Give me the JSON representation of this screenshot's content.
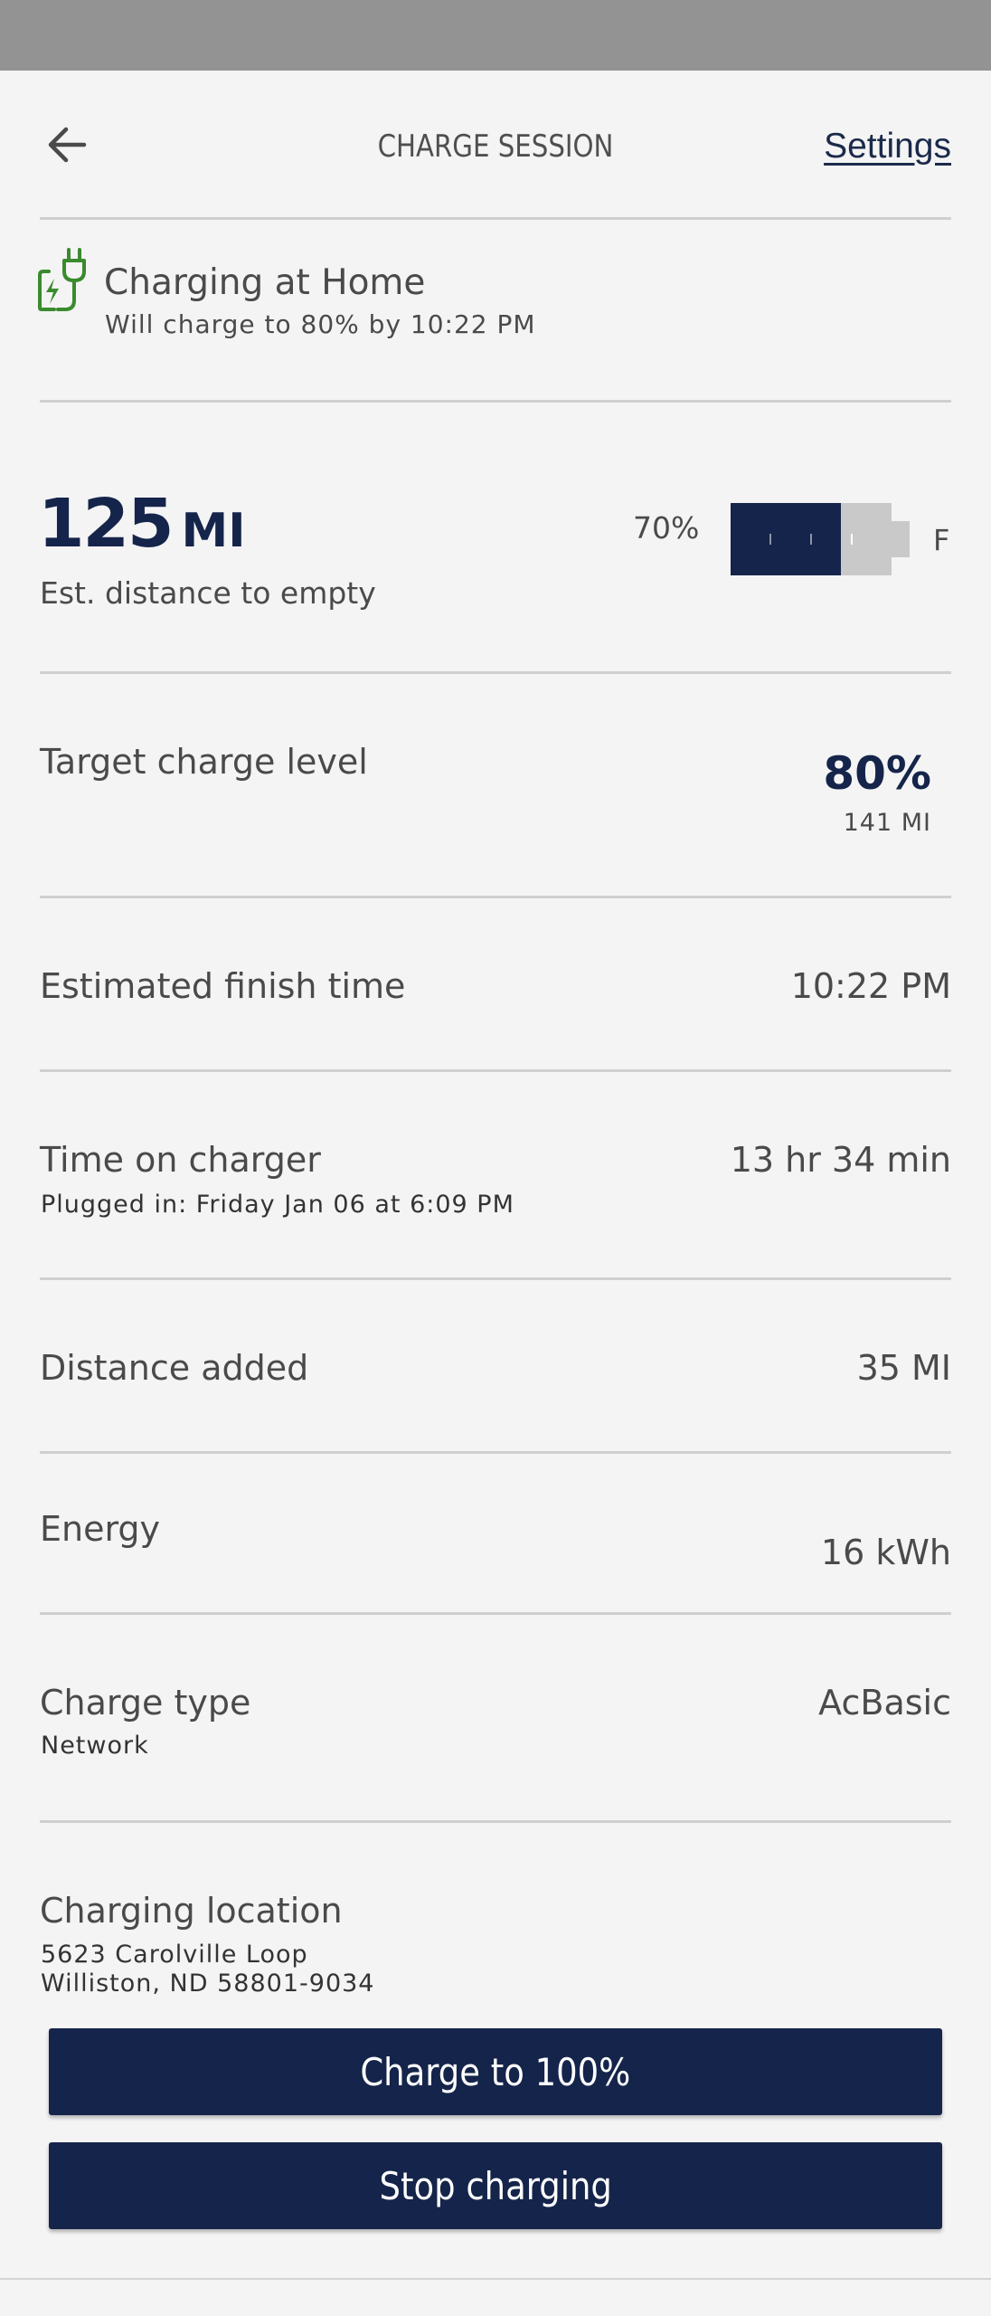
{
  "header": {
    "title": "CHARGE SESSION",
    "settings_label": "Settings"
  },
  "status": {
    "title": "Charging at Home",
    "subtitle": "Will charge to 80% by 10:22 PM"
  },
  "range": {
    "value": "125",
    "unit": "MI",
    "label": "Est. distance to empty",
    "battery_percent_label": "70%",
    "battery_level": 0.7,
    "target_level": 0.8,
    "full_label": "F"
  },
  "target": {
    "label": "Target charge level",
    "value": "80%",
    "sub": "141 MI"
  },
  "rows": {
    "finish": {
      "label": "Estimated finish time",
      "value": "10:22 PM"
    },
    "time_on_charger": {
      "label": "Time on charger",
      "sub": "Plugged in: Friday Jan 06 at 6:09 PM",
      "value": "13 hr 34 min"
    },
    "distance_added": {
      "label": "Distance added",
      "value": "35 MI"
    },
    "energy": {
      "label": "Energy",
      "value": "16 kWh"
    },
    "charge_type": {
      "label": "Charge type",
      "sub": "Network",
      "value": "AcBasic"
    },
    "location": {
      "label": "Charging location",
      "line1": "5623 Carolville Loop",
      "line2": "Williston, ND 58801-9034"
    }
  },
  "buttons": {
    "charge_full": "Charge to 100%",
    "stop": "Stop charging"
  },
  "colors": {
    "primary": "#15244a",
    "accent_green": "#3a8a2e",
    "divider": "#cfcfcf",
    "background": "#f4f4f4"
  }
}
